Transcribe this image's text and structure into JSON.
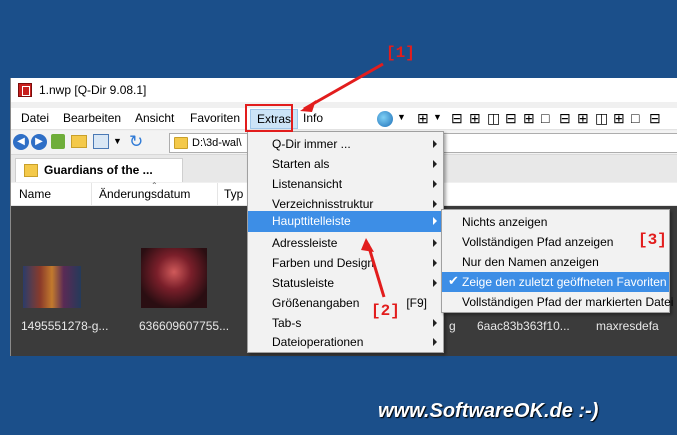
{
  "window": {
    "title": "1.nwp  [Q-Dir 9.08.1]"
  },
  "menubar": {
    "items": [
      {
        "label": "Datei"
      },
      {
        "label": "Bearbeiten"
      },
      {
        "label": "Ansicht"
      },
      {
        "label": "Favoriten"
      },
      {
        "label": "Extras"
      },
      {
        "label": "Info"
      }
    ]
  },
  "addressbar": {
    "path": "D:\\3d-wal\\"
  },
  "tab": {
    "label": "Guardians of the ..."
  },
  "columns": [
    {
      "label": "Name"
    },
    {
      "label": "Änderungsdatum"
    },
    {
      "label": "Typ"
    }
  ],
  "files": [
    {
      "name": "1495551278-g..."
    },
    {
      "name": "636609607755..."
    },
    {
      "name": "g"
    },
    {
      "name": "6aac83b363f10..."
    },
    {
      "name": "maxresdefa"
    }
  ],
  "extras_menu": {
    "items": [
      {
        "label": "Q-Dir immer ...",
        "submenu": true
      },
      {
        "label": "Starten als",
        "submenu": true
      },
      {
        "label": "Listenansicht",
        "submenu": true
      },
      {
        "label": "Verzeichnisstruktur",
        "submenu": true
      },
      {
        "label": "Haupttitelleiste",
        "submenu": true,
        "highlighted": true
      },
      {
        "label": "Adressleiste",
        "submenu": true
      },
      {
        "label": "Farben und Design",
        "submenu": true
      },
      {
        "label": "Statusleiste",
        "submenu": true
      },
      {
        "label": "Größenangaben",
        "shortcut": "[F9]"
      },
      {
        "label": "Tab-s",
        "submenu": true
      },
      {
        "label": "Dateioperationen",
        "submenu": true
      }
    ]
  },
  "title_submenu": {
    "items": [
      {
        "label": "Nichts anzeigen"
      },
      {
        "label": "Vollständigen Pfad anzeigen"
      },
      {
        "label": "Nur den Namen anzeigen"
      },
      {
        "label": "Zeige den zuletzt geöffneten Favoriten",
        "checked": true,
        "highlighted": true,
        "check_mark": "✔"
      },
      {
        "label": "Vollständigen Pfad der markierten Datei"
      }
    ]
  },
  "annotations": {
    "one": "[1]",
    "two": "[2]",
    "three": "[3]"
  },
  "watermark": "www.SoftwareOK.de :-)",
  "colors": {
    "annotation": "#e21d1d",
    "highlight": "#3d8ee6",
    "background": "#1b4f8a"
  }
}
